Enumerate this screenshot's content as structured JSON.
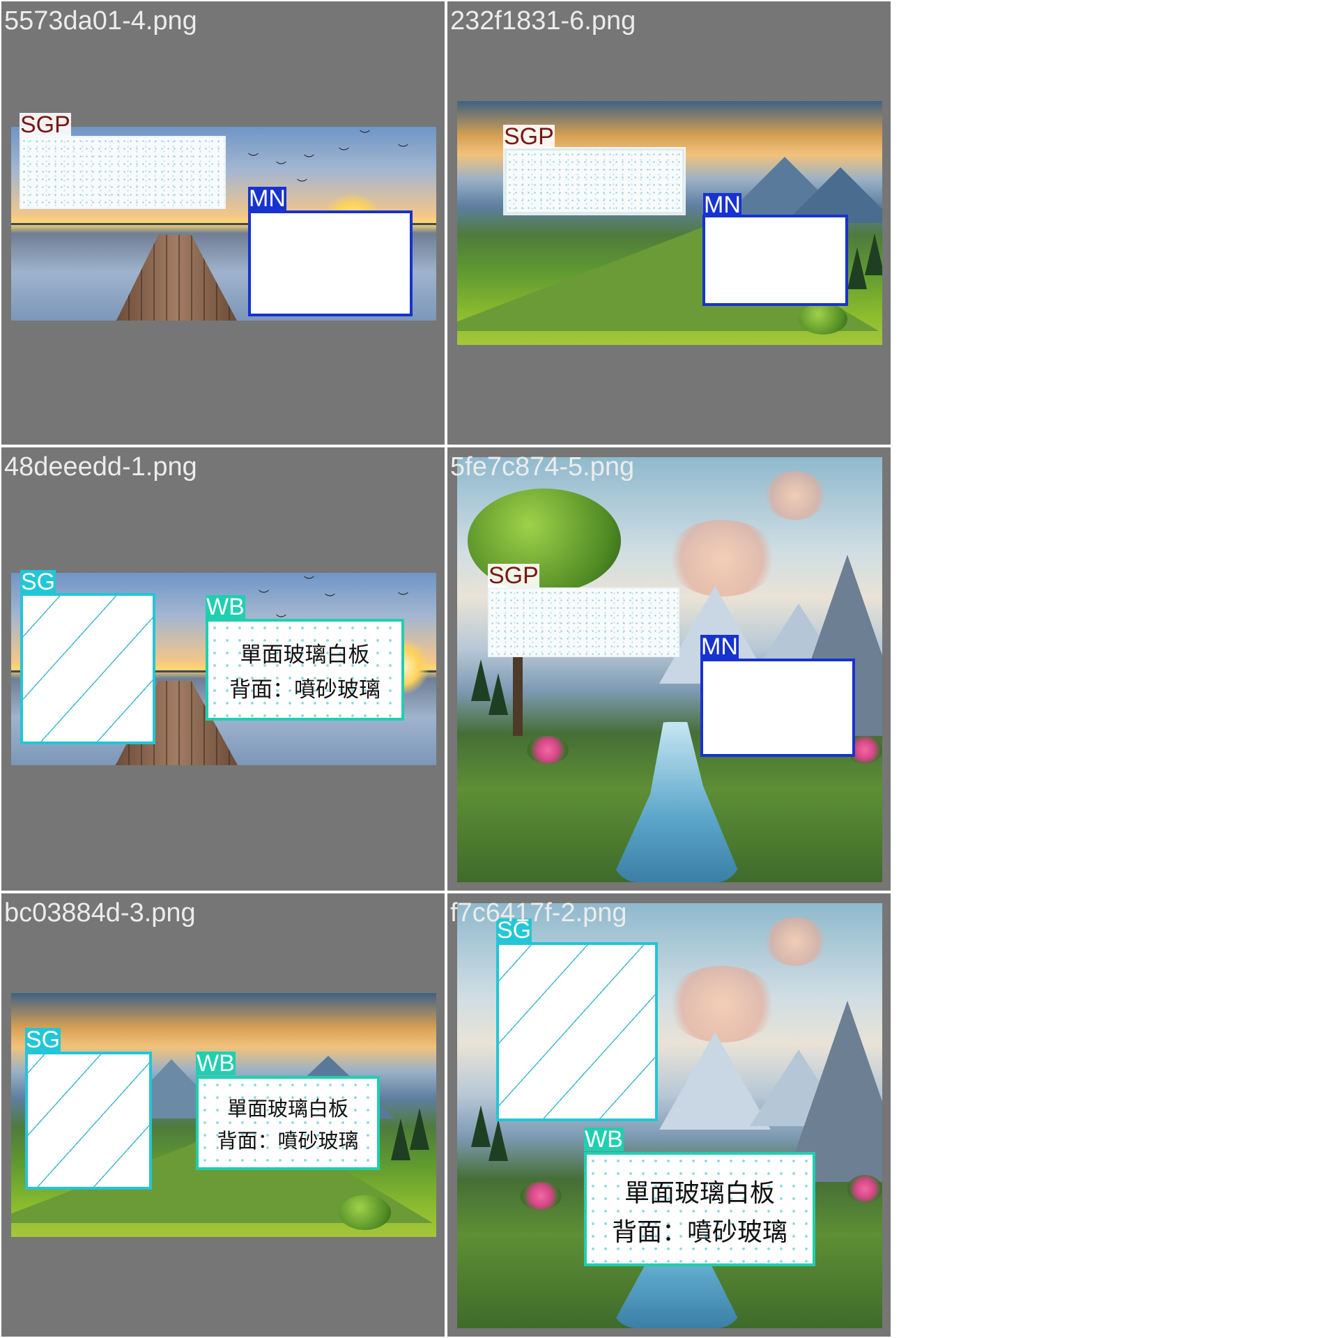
{
  "cells": [
    {
      "label": "5573da01-4.png",
      "markers": [
        "SGP",
        "MN"
      ]
    },
    {
      "label": "232f1831-6.png",
      "markers": [
        "SGP",
        "MN"
      ]
    },
    {
      "label": "48deeedd-1.png",
      "markers": [
        "SG",
        "WB"
      ]
    },
    {
      "label": "5fe7c874-5.png",
      "markers": [
        "SGP",
        "MN"
      ]
    },
    {
      "label": "bc03884d-3.png",
      "markers": [
        "SG",
        "WB"
      ]
    },
    {
      "label": "f7c6417f-2.png",
      "markers": [
        "SG",
        "WB"
      ]
    }
  ],
  "marker_text": {
    "sgp": "SGP",
    "mn": "MN",
    "sg": "SG",
    "wb": "WB"
  },
  "whiteboard": {
    "line1": "單面玻璃白板",
    "line2": "背面：噴砂玻璃"
  },
  "colors": {
    "background": "#767676",
    "label": "#ececec",
    "sgp": "#7a1612",
    "mn": "#1732d0",
    "sg": "#22c6d6",
    "wb": "#1fcfb0"
  }
}
